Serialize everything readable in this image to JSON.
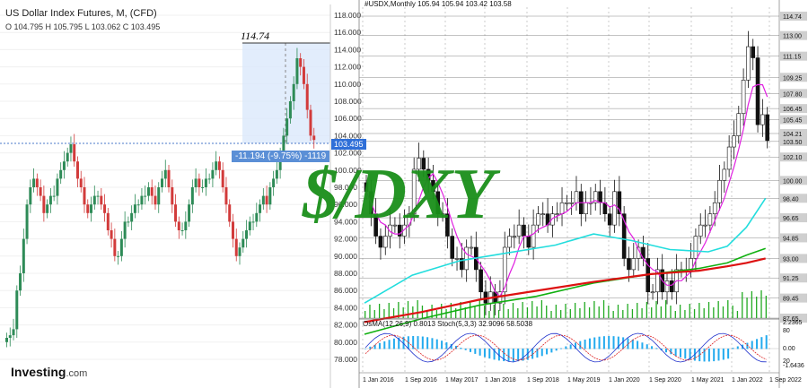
{
  "left_chart": {
    "title": "US Dollar Index Futures, M, (CFD)",
    "ohlc": "O 104.795 H 105.795 L 103.062 C 103.495",
    "price_labels": [
      "118.000",
      "116.000",
      "114.000",
      "112.000",
      "110.000",
      "108.000",
      "106.000",
      "104.000",
      "102.000",
      "100.000",
      "98.000",
      "96.000",
      "94.000",
      "92.000",
      "90.000",
      "88.000",
      "86.000",
      "84.000",
      "82.000",
      "80.000",
      "78.000"
    ],
    "current_price": "103.495",
    "measure_high": "114.74",
    "measure_change": "-11.194 (-9.75%) -1119",
    "logo_text": "Investing",
    "logo_domain": ".com"
  },
  "right_chart": {
    "title": "#USDX,Monthly  105.94 105.94 103.42 103.58",
    "price_labels": [
      "114.74",
      "113.00",
      "111.15",
      "109.25",
      "107.80",
      "106.45",
      "105.45",
      "104.21",
      "103.50",
      "102.10",
      "100.00",
      "98.40",
      "96.65",
      "94.85",
      "93.00",
      "91.25",
      "89.45",
      "87.65"
    ],
    "date_labels": [
      "1 Jan 2016",
      "1 Sep 2016",
      "1 May 2017",
      "1 Jan 2018",
      "1 Sep 2018",
      "1 May 2019",
      "1 Jan 2020",
      "1 Sep 2020",
      "1 May 2021",
      "1 Jan 2022",
      "1 Sep 2022"
    ],
    "osma_title": "OsMA(12,26,9) 0.8013  Stoch(5,3,3) 32.9096 58.5038",
    "osma_labels": [
      "2.2365",
      "80",
      "0.00",
      "20",
      "-1.6436"
    ]
  },
  "watermark": "$/DXY",
  "colors": {
    "bull": "#2e8b57",
    "bear": "#d23b3b",
    "ma_magenta": "#e020e0",
    "ma_cyan": "#22dddd",
    "ma_green": "#10b010",
    "ma_red": "#dd1111",
    "volume": "#22aa22",
    "osma": "#22aaee",
    "accent": "#2f6fd8",
    "watermark": "#1a8f1a"
  },
  "chart_data": [
    {
      "type": "candlestick",
      "title": "US Dollar Index Futures, M, (CFD)",
      "ylim": [
        78,
        119
      ],
      "close_series": [
        80.5,
        80.8,
        81.5,
        86,
        88,
        92,
        96,
        98,
        99,
        98,
        97,
        95,
        96,
        97,
        97,
        99,
        100,
        101,
        102,
        103,
        101,
        99,
        98,
        96,
        95,
        96,
        97,
        97,
        96,
        95,
        93,
        92,
        90,
        90,
        92,
        94,
        94,
        95,
        96,
        96,
        97,
        97,
        98,
        97,
        96,
        98,
        99,
        100,
        98,
        96,
        94,
        93,
        93,
        94,
        96,
        98,
        99,
        98,
        98,
        99,
        99,
        100,
        101,
        100,
        98,
        96,
        94,
        92,
        90,
        91,
        92,
        93,
        94,
        94,
        95,
        96,
        97,
        96,
        98,
        99,
        100,
        102,
        104,
        106,
        108,
        110,
        113,
        112,
        110,
        107,
        104,
        103.5
      ],
      "current": 103.495,
      "measure_high": 114.74,
      "measure_change_pct": -9.75
    },
    {
      "type": "candlestick",
      "title": "#USDX,Monthly",
      "ylim": [
        87.65,
        114.74
      ],
      "close": [
        99,
        97,
        95,
        94,
        95,
        96,
        96,
        95,
        96,
        97,
        101,
        102,
        101,
        100,
        99,
        97,
        97,
        95,
        93,
        93,
        92,
        94,
        94,
        92,
        90,
        89,
        90,
        89,
        90,
        94,
        95,
        95,
        96,
        95,
        94,
        96,
        97,
        97,
        96,
        97,
        97,
        98,
        98,
        98,
        99,
        97,
        98,
        98,
        99,
        98,
        97,
        96,
        99,
        97,
        93,
        92,
        93,
        94,
        93,
        90,
        90,
        92,
        90,
        91,
        90,
        92,
        92,
        92,
        93,
        95,
        96,
        96,
        97,
        98,
        100,
        101,
        103,
        104,
        106,
        109,
        112,
        111,
        105,
        105.9,
        103.58
      ],
      "ma_magenta_last": 106.5,
      "ma_cyan_last": 98.4,
      "ma_green_last": 93.9,
      "ma_red_last": 93.0
    }
  ]
}
